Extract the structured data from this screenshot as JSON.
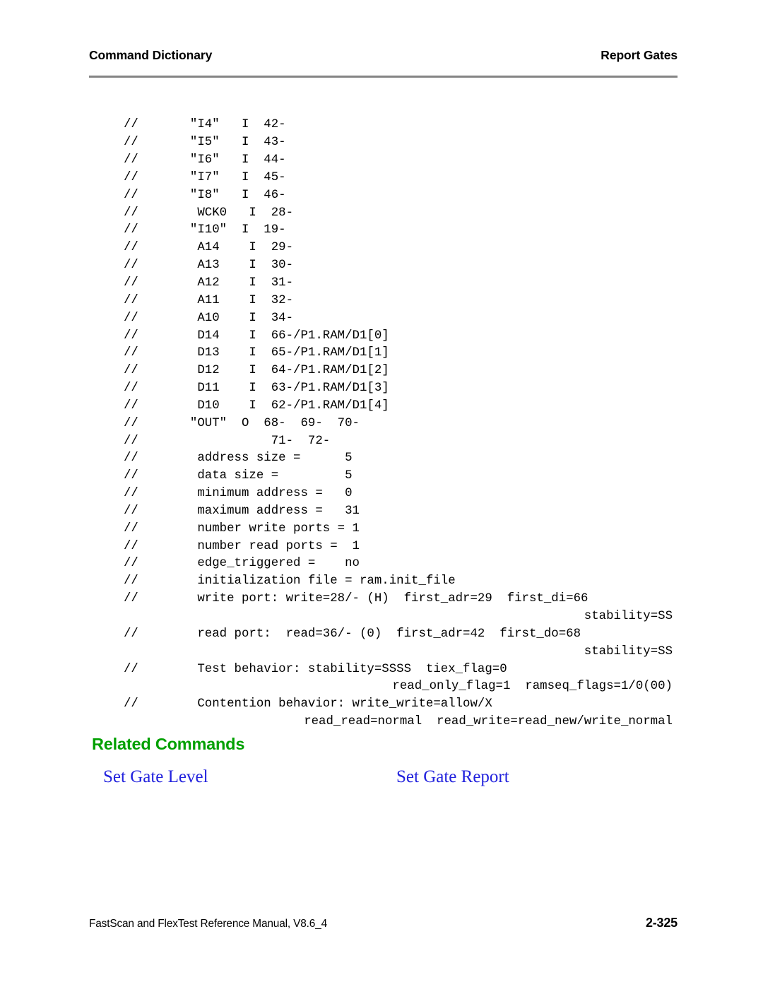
{
  "header": {
    "left_title": "Command Dictionary",
    "right_title": "Report Gates"
  },
  "code_block": {
    "lines": [
      "//       \"I4\"   I  42-",
      "//       \"I5\"   I  43-",
      "//       \"I6\"   I  44-",
      "//       \"I7\"   I  45-",
      "//       \"I8\"   I  46-",
      "//        WCK0   I  28-",
      "//       \"I10\"  I  19-",
      "//        A14    I  29-",
      "//        A13    I  30-",
      "//        A12    I  31-",
      "//        A11    I  32-",
      "//        A10    I  34-",
      "//        D14    I  66-/P1.RAM/D1[0]",
      "//        D13    I  65-/P1.RAM/D1[1]",
      "//        D12    I  64-/P1.RAM/D1[2]",
      "//        D11    I  63-/P1.RAM/D1[3]",
      "//        D10    I  62-/P1.RAM/D1[4]",
      "//       \"OUT\"  O  68-  69-  70-",
      "//                  71-  72-",
      "//        address size =      5",
      "//        data size =         5",
      "//        minimum address =   0",
      "//        maximum address =   31",
      "//        number write ports = 1",
      "//        number read ports =  1",
      "//        edge_triggered =    no",
      "//        initialization file = ram.init_file",
      "//        write port: write=28/- (H)  first_adr=29  first_di=66",
      "stability=SS",
      "//        read port:  read=36/- (0)  first_adr=42  first_do=68",
      "stability=SS",
      "//        Test behavior: stability=SSSS  tiex_flag=0",
      "read_only_flag=1  ramseq_flags=1/0(00)",
      "//        Contention behavior: write_write=allow/X",
      "read_read=normal  read_write=read_new/write_normal"
    ],
    "right_aligned_indices": [
      28,
      30,
      32,
      34
    ]
  },
  "related": {
    "heading": "Related Commands",
    "heading_color": "#00a000",
    "link_color": "#2222dd",
    "links": [
      {
        "label": "Set Gate Level"
      },
      {
        "label": "Set Gate Report"
      }
    ]
  },
  "footer": {
    "manual_title": "FastScan and FlexTest Reference Manual, V8.6_4",
    "page_number": "2-325"
  }
}
